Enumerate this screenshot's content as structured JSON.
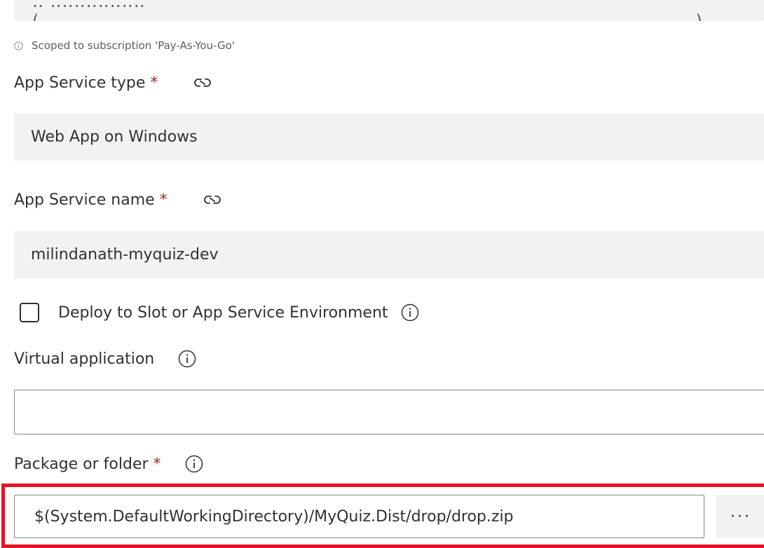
{
  "subscription": {
    "scope_note": "Scoped to subscription 'Pay-As-You-Go'"
  },
  "app_service_type": {
    "label": "App Service type",
    "required_marker": "*",
    "value": "Web App on Windows"
  },
  "app_service_name": {
    "label": "App Service name",
    "required_marker": "*",
    "value": "milindanath-myquiz-dev"
  },
  "deploy_slot": {
    "label": "Deploy to Slot or App Service Environment",
    "checked": false
  },
  "virtual_application": {
    "label": "Virtual application",
    "value": ""
  },
  "package_or_folder": {
    "label": "Package or folder",
    "required_marker": "*",
    "value": "$(System.DefaultWorkingDirectory)/MyQuiz.Dist/drop/drop.zip",
    "browse_label": "···"
  },
  "colors": {
    "field_background": "#f3f2f1",
    "required": "#a4262c",
    "highlight": "#e81123",
    "text": "#323130"
  }
}
